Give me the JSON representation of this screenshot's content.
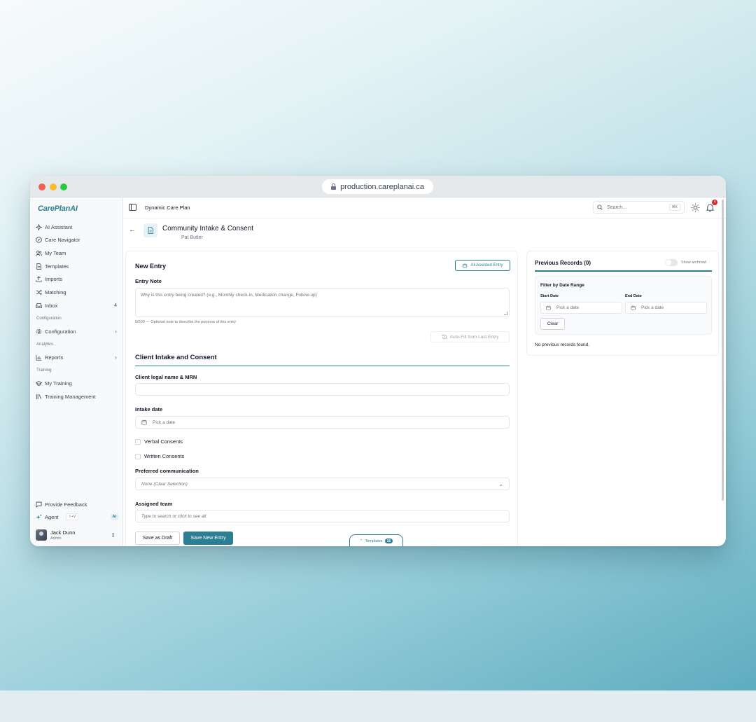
{
  "browser": {
    "url": "production.careplanai.ca"
  },
  "sidebar": {
    "logo": "CarePlanAI",
    "items": [
      {
        "label": "AI Assistant",
        "icon": "sparkle-icon"
      },
      {
        "label": "Care Navigator",
        "icon": "compass-icon"
      },
      {
        "label": "My Team",
        "icon": "users-icon"
      },
      {
        "label": "Templates",
        "icon": "file-icon"
      },
      {
        "label": "Imports",
        "icon": "upload-icon"
      },
      {
        "label": "Matching",
        "icon": "shuffle-icon"
      },
      {
        "label": "Inbox",
        "icon": "inbox-icon",
        "badge": "4"
      }
    ],
    "section_configuration": "Configuration",
    "configuration_item": "Configuration",
    "section_analytics": "Analytics",
    "reports_item": "Reports",
    "section_training": "Training",
    "my_training": "My Training",
    "training_management": "Training Management",
    "feedback": "Provide Feedback",
    "agent": "Agent",
    "agent_shortcut": "⇧+V",
    "agent_badge": "AI",
    "user_name": "Jack Dunn",
    "user_role": "Admin"
  },
  "topbar": {
    "breadcrumb": "Dynamic Care Plan",
    "search_placeholder": "Search...",
    "search_shortcut": "⌘K",
    "notification_count": "4"
  },
  "page": {
    "title": "Community Intake & Consent",
    "subtitle": "Pat Butler"
  },
  "entry": {
    "heading": "New Entry",
    "ai_button": "AI-Assisted Entry",
    "note_label": "Entry Note",
    "note_placeholder": "Why is this entry being created? (e.g., Monthly check-in, Medication change, Follow-up)",
    "note_hint": "0/500 — Optional note to describe the purpose of this entry",
    "autofill_button": "Auto-Fill from Last Entry"
  },
  "form": {
    "section_title": "Client Intake and Consent",
    "name_label": "Client legal name & MRN",
    "name_value": "",
    "intake_label": "Intake date",
    "intake_placeholder": "Pick a date",
    "verbal_consents": "Verbal Consents",
    "written_consents": "Written Consents",
    "communication_label": "Preferred communication",
    "communication_value": "None (Clear Selection)",
    "team_label": "Assigned team",
    "team_placeholder": "Type to search or click to see all",
    "save_draft": "Save as Draft",
    "save_new": "Save New Entry",
    "templates_tab": "Templates",
    "templates_count": "16"
  },
  "records": {
    "title": "Previous Records (0)",
    "show_archived": "Show archived",
    "filter_title": "Filter by Date Range",
    "start_label": "Start Date",
    "start_placeholder": "Pick a date",
    "end_label": "End Date",
    "end_placeholder": "Pick a date",
    "clear": "Clear",
    "empty": "No previous records found."
  },
  "colors": {
    "accent": "#2c7f92",
    "notification": "#dc2626"
  }
}
